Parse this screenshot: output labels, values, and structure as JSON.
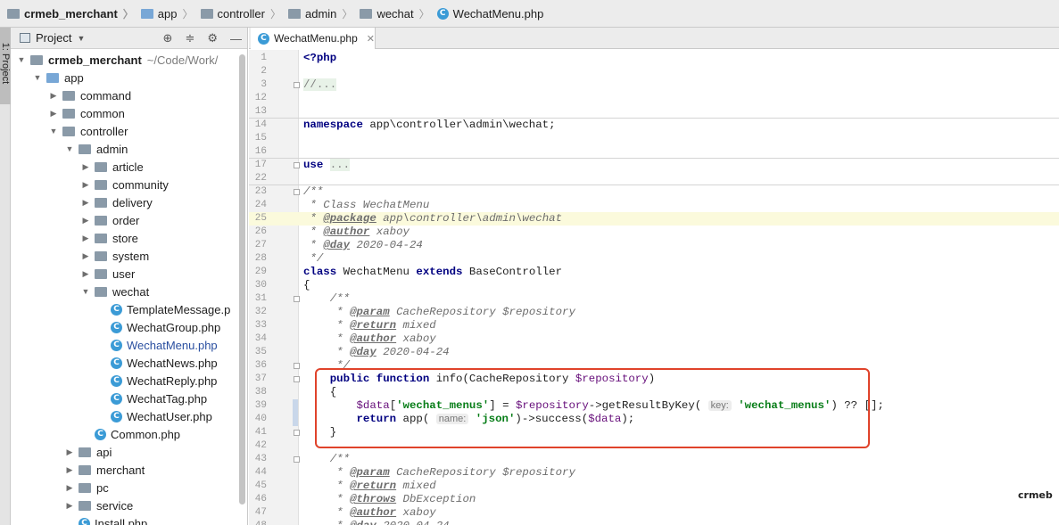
{
  "breadcrumb": [
    {
      "label": "crmeb_merchant",
      "icon": "folder-icon"
    },
    {
      "label": "app",
      "icon": "folder-icon"
    },
    {
      "label": "controller",
      "icon": "folder-icon"
    },
    {
      "label": "admin",
      "icon": "folder-icon"
    },
    {
      "label": "wechat",
      "icon": "folder-icon"
    },
    {
      "label": "WechatMenu.php",
      "icon": "php-class-file-icon"
    }
  ],
  "tool_strip": {
    "tab_label": "1: Project"
  },
  "project_panel": {
    "title": "Project",
    "tree": [
      {
        "label": "crmeb_merchant",
        "extra": "~/Code/Work/",
        "depth": 0,
        "expanded": true,
        "type": "folder",
        "bold": true
      },
      {
        "label": "app",
        "depth": 1,
        "expanded": true,
        "type": "folder-blue"
      },
      {
        "label": "command",
        "depth": 2,
        "expanded": false,
        "type": "folder"
      },
      {
        "label": "common",
        "depth": 2,
        "expanded": false,
        "type": "folder"
      },
      {
        "label": "controller",
        "depth": 2,
        "expanded": true,
        "type": "folder"
      },
      {
        "label": "admin",
        "depth": 3,
        "expanded": true,
        "type": "folder"
      },
      {
        "label": "article",
        "depth": 4,
        "expanded": false,
        "type": "folder"
      },
      {
        "label": "community",
        "depth": 4,
        "expanded": false,
        "type": "folder"
      },
      {
        "label": "delivery",
        "depth": 4,
        "expanded": false,
        "type": "folder"
      },
      {
        "label": "order",
        "depth": 4,
        "expanded": false,
        "type": "folder"
      },
      {
        "label": "store",
        "depth": 4,
        "expanded": false,
        "type": "folder"
      },
      {
        "label": "system",
        "depth": 4,
        "expanded": false,
        "type": "folder"
      },
      {
        "label": "user",
        "depth": 4,
        "expanded": false,
        "type": "folder"
      },
      {
        "label": "wechat",
        "depth": 4,
        "expanded": true,
        "type": "folder"
      },
      {
        "label": "TemplateMessage.p",
        "depth": 5,
        "type": "file"
      },
      {
        "label": "WechatGroup.php",
        "depth": 5,
        "type": "file"
      },
      {
        "label": "WechatMenu.php",
        "depth": 5,
        "type": "file",
        "selected": true
      },
      {
        "label": "WechatNews.php",
        "depth": 5,
        "type": "file"
      },
      {
        "label": "WechatReply.php",
        "depth": 5,
        "type": "file"
      },
      {
        "label": "WechatTag.php",
        "depth": 5,
        "type": "file"
      },
      {
        "label": "WechatUser.php",
        "depth": 5,
        "type": "file"
      },
      {
        "label": "Common.php",
        "depth": 4,
        "type": "file"
      },
      {
        "label": "api",
        "depth": 3,
        "expanded": false,
        "type": "folder"
      },
      {
        "label": "merchant",
        "depth": 3,
        "expanded": false,
        "type": "folder"
      },
      {
        "label": "pc",
        "depth": 3,
        "expanded": false,
        "type": "folder"
      },
      {
        "label": "service",
        "depth": 3,
        "expanded": false,
        "type": "folder"
      },
      {
        "label": "Install.php",
        "depth": 3,
        "type": "file"
      }
    ]
  },
  "editor": {
    "tab_label": "WechatMenu.php",
    "current_line": "25",
    "lines": [
      {
        "n": "1",
        "seg": [
          [
            "kw",
            "<?php"
          ]
        ]
      },
      {
        "n": "2",
        "seg": []
      },
      {
        "n": "3",
        "seg": [
          [
            "fold",
            "//..."
          ]
        ],
        "fold": true
      },
      {
        "n": "12",
        "seg": []
      },
      {
        "n": "13",
        "seg": [],
        "sep": true
      },
      {
        "n": "14",
        "seg": [
          [
            "kw",
            "namespace"
          ],
          [
            "",
            " app\\controller\\admin\\wechat;"
          ]
        ]
      },
      {
        "n": "15",
        "seg": []
      },
      {
        "n": "16",
        "seg": [],
        "sep": true
      },
      {
        "n": "17",
        "seg": [
          [
            "kw",
            "use"
          ],
          [
            "",
            " "
          ],
          [
            "fold",
            "..."
          ]
        ],
        "fold": true
      },
      {
        "n": "22",
        "seg": [],
        "sep": true
      },
      {
        "n": "23",
        "seg": [
          [
            "cm",
            "/**"
          ]
        ],
        "fold": true
      },
      {
        "n": "24",
        "seg": [
          [
            "cm",
            " * Class WechatMenu"
          ]
        ]
      },
      {
        "n": "25",
        "seg": [
          [
            "cm",
            " * "
          ],
          [
            "tag",
            "@package"
          ],
          [
            "cm",
            " app\\controller\\admin\\wechat"
          ]
        ]
      },
      {
        "n": "26",
        "seg": [
          [
            "cm",
            " * "
          ],
          [
            "tag",
            "@author"
          ],
          [
            "cm",
            " xaboy"
          ]
        ]
      },
      {
        "n": "27",
        "seg": [
          [
            "cm",
            " * "
          ],
          [
            "tag",
            "@day"
          ],
          [
            "cm",
            " 2020-04-24"
          ]
        ]
      },
      {
        "n": "28",
        "seg": [
          [
            "cm",
            " */"
          ]
        ]
      },
      {
        "n": "29",
        "seg": [
          [
            "kw",
            "class"
          ],
          [
            "",
            " WechatMenu "
          ],
          [
            "kw",
            "extends"
          ],
          [
            "",
            " BaseController"
          ]
        ]
      },
      {
        "n": "30",
        "seg": [
          [
            "",
            "{"
          ]
        ]
      },
      {
        "n": "31",
        "seg": [
          [
            "cm",
            "    /**"
          ]
        ],
        "fold": true
      },
      {
        "n": "32",
        "seg": [
          [
            "cm",
            "     * "
          ],
          [
            "tag",
            "@param"
          ],
          [
            "cm",
            " CacheRepository $repository"
          ]
        ]
      },
      {
        "n": "33",
        "seg": [
          [
            "cm",
            "     * "
          ],
          [
            "tag",
            "@return"
          ],
          [
            "cm",
            " mixed"
          ]
        ]
      },
      {
        "n": "34",
        "seg": [
          [
            "cm",
            "     * "
          ],
          [
            "tag",
            "@author"
          ],
          [
            "cm",
            " xaboy"
          ]
        ]
      },
      {
        "n": "35",
        "seg": [
          [
            "cm",
            "     * "
          ],
          [
            "tag",
            "@day"
          ],
          [
            "cm",
            " 2020-04-24"
          ]
        ]
      },
      {
        "n": "36",
        "seg": [
          [
            "cm",
            "     */"
          ]
        ],
        "fold": true
      },
      {
        "n": "37",
        "seg": [
          [
            "",
            "    "
          ],
          [
            "kw",
            "public function"
          ],
          [
            "",
            " info(CacheRepository "
          ],
          [
            "var",
            "$repository"
          ],
          [
            "",
            ")"
          ]
        ],
        "fold": true
      },
      {
        "n": "38",
        "seg": [
          [
            "",
            "    {"
          ]
        ]
      },
      {
        "n": "39",
        "seg": [
          [
            "",
            "        "
          ],
          [
            "var",
            "$data"
          ],
          [
            "",
            "["
          ],
          [
            "str",
            "'wechat_menus'"
          ],
          [
            "",
            "] = "
          ],
          [
            "var",
            "$repository"
          ],
          [
            "",
            "->getResultByKey( "
          ],
          [
            "hint",
            "key:"
          ],
          [
            "",
            " "
          ],
          [
            "str",
            "'wechat_menus'"
          ],
          [
            "",
            ") ?? [];"
          ]
        ],
        "changed": true
      },
      {
        "n": "40",
        "seg": [
          [
            "",
            "        "
          ],
          [
            "kw",
            "return"
          ],
          [
            "",
            " app( "
          ],
          [
            "hint",
            "name:"
          ],
          [
            "",
            " "
          ],
          [
            "str",
            "'json'"
          ],
          [
            "",
            ")->success("
          ],
          [
            "var",
            "$data"
          ],
          [
            "",
            ");"
          ]
        ],
        "changed": true
      },
      {
        "n": "41",
        "seg": [
          [
            "",
            "    }"
          ]
        ],
        "fold": true
      },
      {
        "n": "42",
        "seg": []
      },
      {
        "n": "43",
        "seg": [
          [
            "cm",
            "    /**"
          ]
        ],
        "fold": true
      },
      {
        "n": "44",
        "seg": [
          [
            "cm",
            "     * "
          ],
          [
            "tag",
            "@param"
          ],
          [
            "cm",
            " CacheRepository $repository"
          ]
        ]
      },
      {
        "n": "45",
        "seg": [
          [
            "cm",
            "     * "
          ],
          [
            "tag",
            "@return"
          ],
          [
            "cm",
            " mixed"
          ]
        ]
      },
      {
        "n": "46",
        "seg": [
          [
            "cm",
            "     * "
          ],
          [
            "tag",
            "@throws"
          ],
          [
            "cm",
            " DbException"
          ]
        ]
      },
      {
        "n": "47",
        "seg": [
          [
            "cm",
            "     * "
          ],
          [
            "tag",
            "@author"
          ],
          [
            "cm",
            " xaboy"
          ]
        ]
      },
      {
        "n": "48",
        "seg": [
          [
            "cm",
            "     * "
          ],
          [
            "tag",
            "@day"
          ],
          [
            "cm",
            " 2020-04-24"
          ]
        ]
      }
    ]
  },
  "watermark": "crmeb",
  "colors": {
    "highlight_box": "#e0432b",
    "keyword": "#000080",
    "string": "#067d17",
    "variable": "#660e7a"
  }
}
